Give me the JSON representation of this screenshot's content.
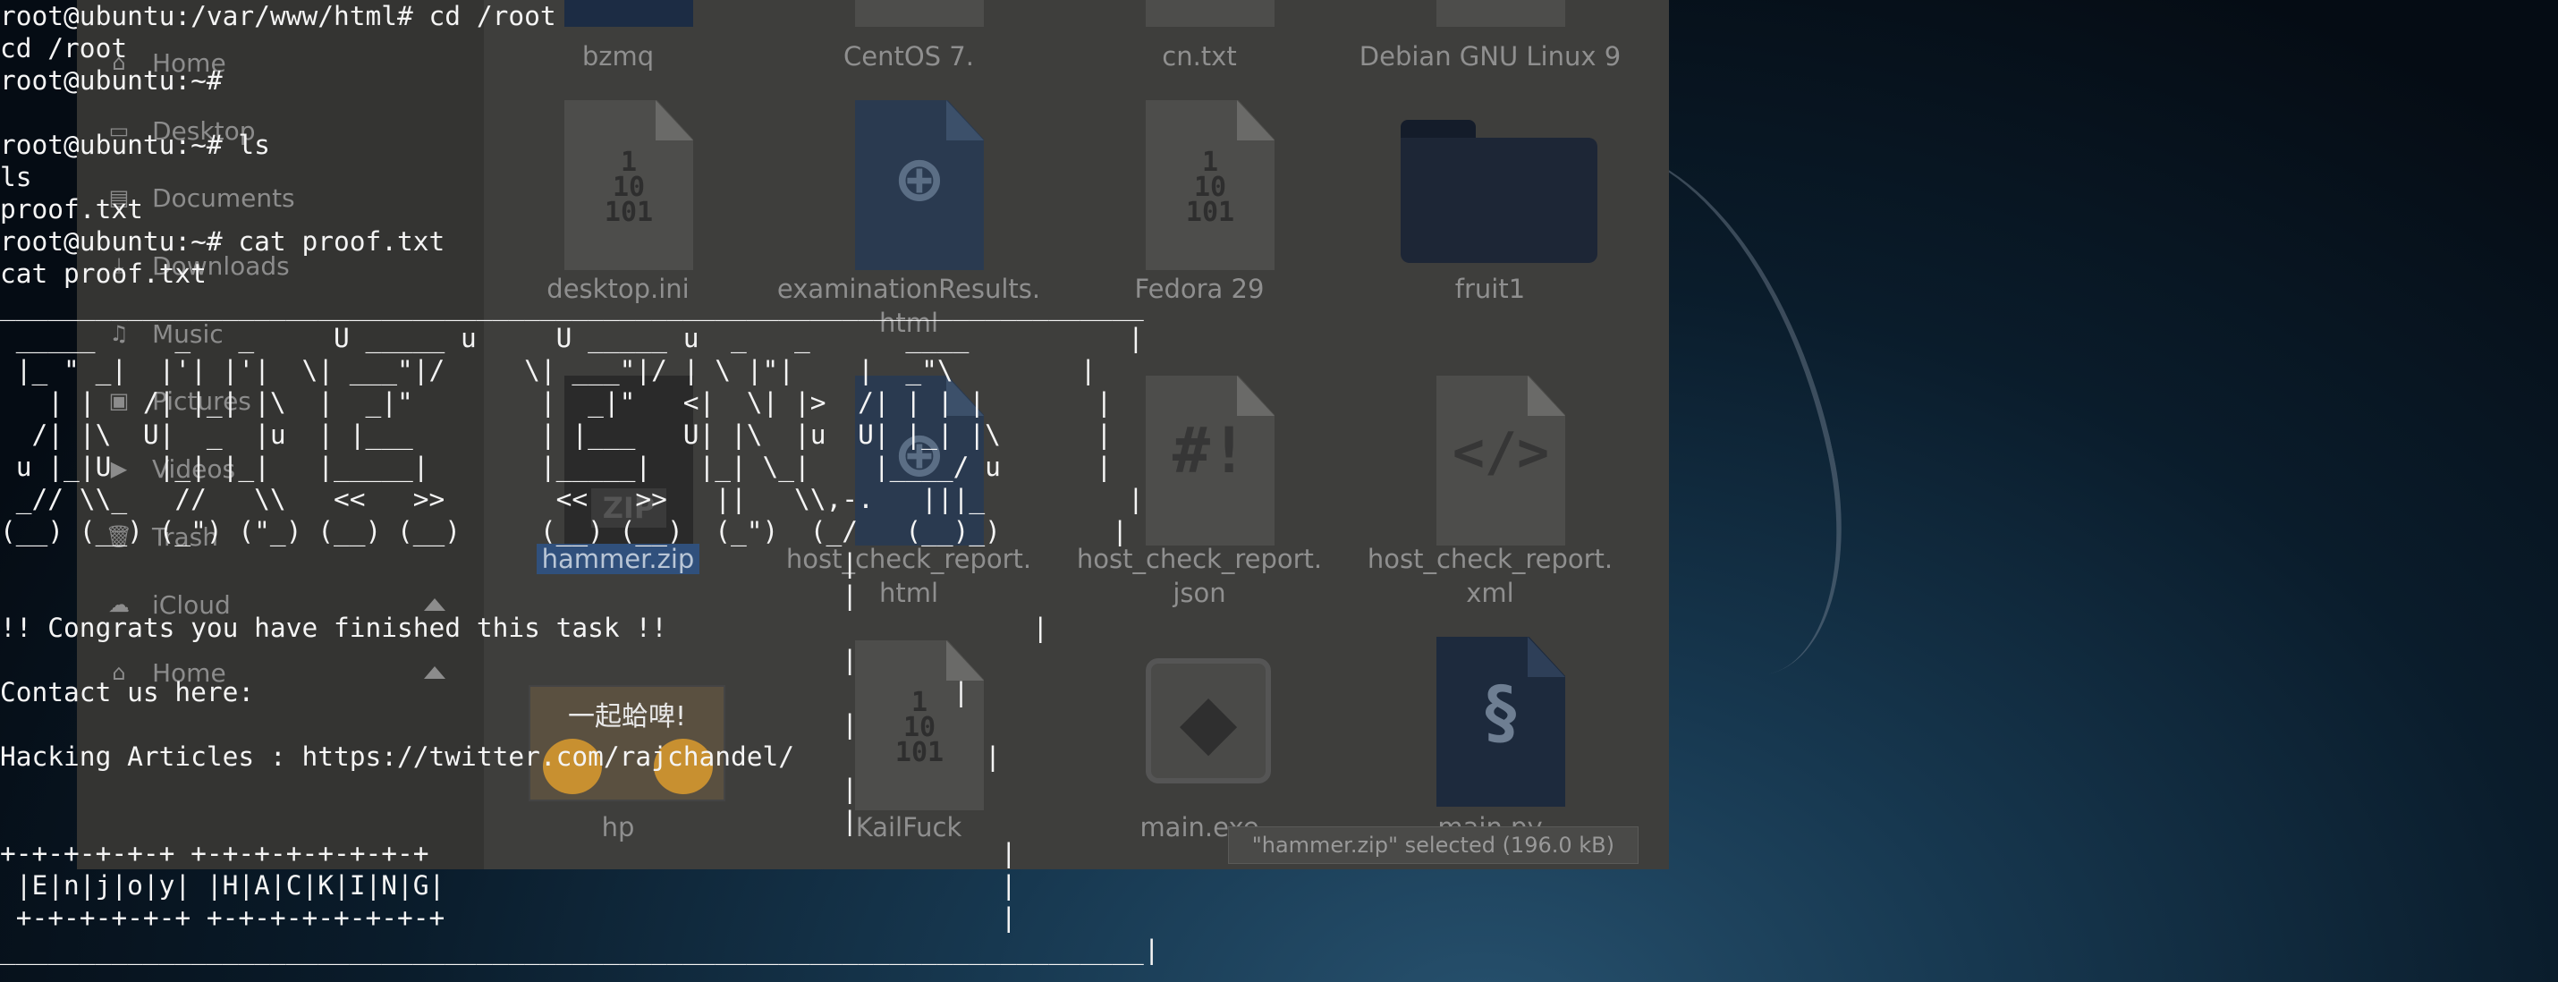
{
  "sidebar": {
    "items": [
      {
        "label": "Home",
        "icon": "home-icon"
      },
      {
        "label": "Desktop",
        "icon": "desktop-icon"
      },
      {
        "label": "Documents",
        "icon": "documents-icon"
      },
      {
        "label": "Downloads",
        "icon": "downloads-icon"
      },
      {
        "label": "Music",
        "icon": "music-icon"
      },
      {
        "label": "Pictures",
        "icon": "pictures-icon"
      },
      {
        "label": "Videos",
        "icon": "videos-icon"
      },
      {
        "label": "Trash",
        "icon": "trash-icon"
      },
      {
        "label": "iCloud",
        "icon": "cloud-icon"
      },
      {
        "label": "Home",
        "icon": "home-icon"
      }
    ]
  },
  "files": [
    {
      "name": "bzmq",
      "icon": "document-icon"
    },
    {
      "name": "CentOS 7.",
      "icon": "document-icon"
    },
    {
      "name": "cn.txt",
      "icon": "text-file-icon"
    },
    {
      "name": "Debian GNU Linux 9",
      "icon": "document-icon"
    },
    {
      "name": "desktop.ini",
      "icon": "binary-file-icon"
    },
    {
      "name": "examinationResults.\nhtml",
      "icon": "html-file-icon"
    },
    {
      "name": "Fedora 29",
      "icon": "binary-file-icon"
    },
    {
      "name": "fruit1",
      "icon": "folder-icon"
    },
    {
      "name": "hammer.zip",
      "icon": "zip-file-icon",
      "selected": true
    },
    {
      "name": "host_check_report.\nhtml",
      "icon": "html-file-icon"
    },
    {
      "name": "host_check_report.\njson",
      "icon": "script-file-icon"
    },
    {
      "name": "host_check_report.\nxml",
      "icon": "code-file-icon"
    },
    {
      "name": "hp",
      "icon": "image-file-icon",
      "thumb_text": "一起蛤啤!"
    },
    {
      "name": "KailFuck",
      "icon": "binary-file-icon"
    },
    {
      "name": "main.exe",
      "icon": "exe-file-icon"
    },
    {
      "name": "main.py",
      "icon": "python-file-icon"
    }
  ],
  "statusbar": "\"hammer.zip\" selected  (196.0 kB)",
  "terminal": {
    "lines": [
      "root@ubuntu:/var/www/html# cd /root",
      "cd /root",
      "root@ubuntu:~# ",
      "",
      "root@ubuntu:~# ls",
      "ls",
      "proof.txt",
      "root@ubuntu:~# cat proof.txt",
      "cat proof.txt",
      "________________________________________________________________________",
      " _____     _   _     U _____ u     U _____ u  _   _      ____          |",
      " |_ \" _|  |'| |'|  \\| ___\"|/     \\| ___\"|/ | \\ |\"|    |  _\"\\        |",
      "   | |   /| |_| |\\  |  _|\"        |  _|\"   <|  \\| |>  /| | | |       |",
      "  /| |\\  U|  _  |u  | |___        | |___   U| |\\  |u  U| |_| |\\      |",
      " u |_|U   |_| |_|   |_____|       |_____|   |_| \\_|    |____/ u      |",
      " _// \\\\_   //   \\\\   <<   >>       <<   >>   ||   \\\\,-.   |||_         |",
      "(__) (__) (_\") (\"_) (__) (__)     (__) (__)  (_\")  (_/   (__)_)       |",
      "                                                     |",
      "                                                     |",
      "!! Congrats you have finished this task !!                       |",
      "                                                     |",
      "Contact us here:                                            |",
      "                                                     |",
      "Hacking Articles : https://twitter.com/rajchandel/            |",
      "                                                     |",
      "                                                     |",
      "+-+-+-+-+-+ +-+-+-+-+-+-+-+                                    |",
      " |E|n|j|o|y| |H|A|C|K|I|N|G|                                   |",
      " +-+-+-+-+-+ +-+-+-+-+-+-+-+                                   |",
      "________________________________________________________________________|"
    ]
  }
}
